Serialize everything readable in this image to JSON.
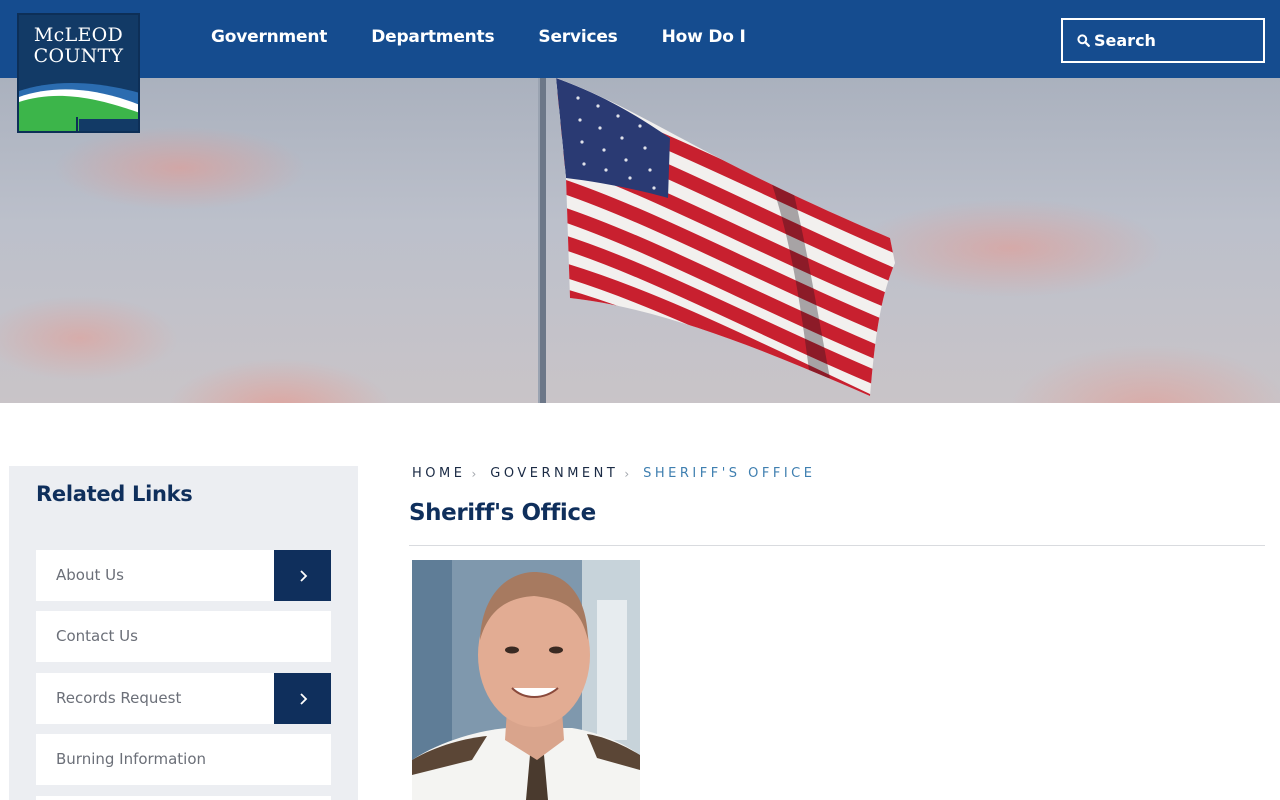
{
  "logo": {
    "line1": "McLEOD",
    "line2": "COUNTY",
    "colors": {
      "bg": "#123a66",
      "green": "#3cb54a",
      "blue": "#2b6cb0"
    }
  },
  "nav": {
    "items": [
      {
        "label": "Government"
      },
      {
        "label": "Departments"
      },
      {
        "label": "Services"
      },
      {
        "label": "How Do I"
      }
    ]
  },
  "search": {
    "label": "Search",
    "icon": "search-icon"
  },
  "hero": {
    "image": "american-flag-on-pole-against-pink-cloudy-sky"
  },
  "sidebar": {
    "title": "Related Links",
    "items": [
      {
        "label": "About Us",
        "has_submenu": true
      },
      {
        "label": "Contact Us",
        "has_submenu": false
      },
      {
        "label": "Records Request",
        "has_submenu": true
      },
      {
        "label": "Burning Information",
        "has_submenu": false
      }
    ]
  },
  "breadcrumb": {
    "items": [
      "HOME",
      "GOVERNMENT",
      "SHERIFF'S OFFICE"
    ]
  },
  "page": {
    "title": "Sheriff's Office"
  },
  "colors": {
    "header": "#154c8f",
    "navy": "#0f2f5c",
    "sidebar_bg": "#eceef2",
    "breadcrumb_current": "#3f7fb0"
  }
}
